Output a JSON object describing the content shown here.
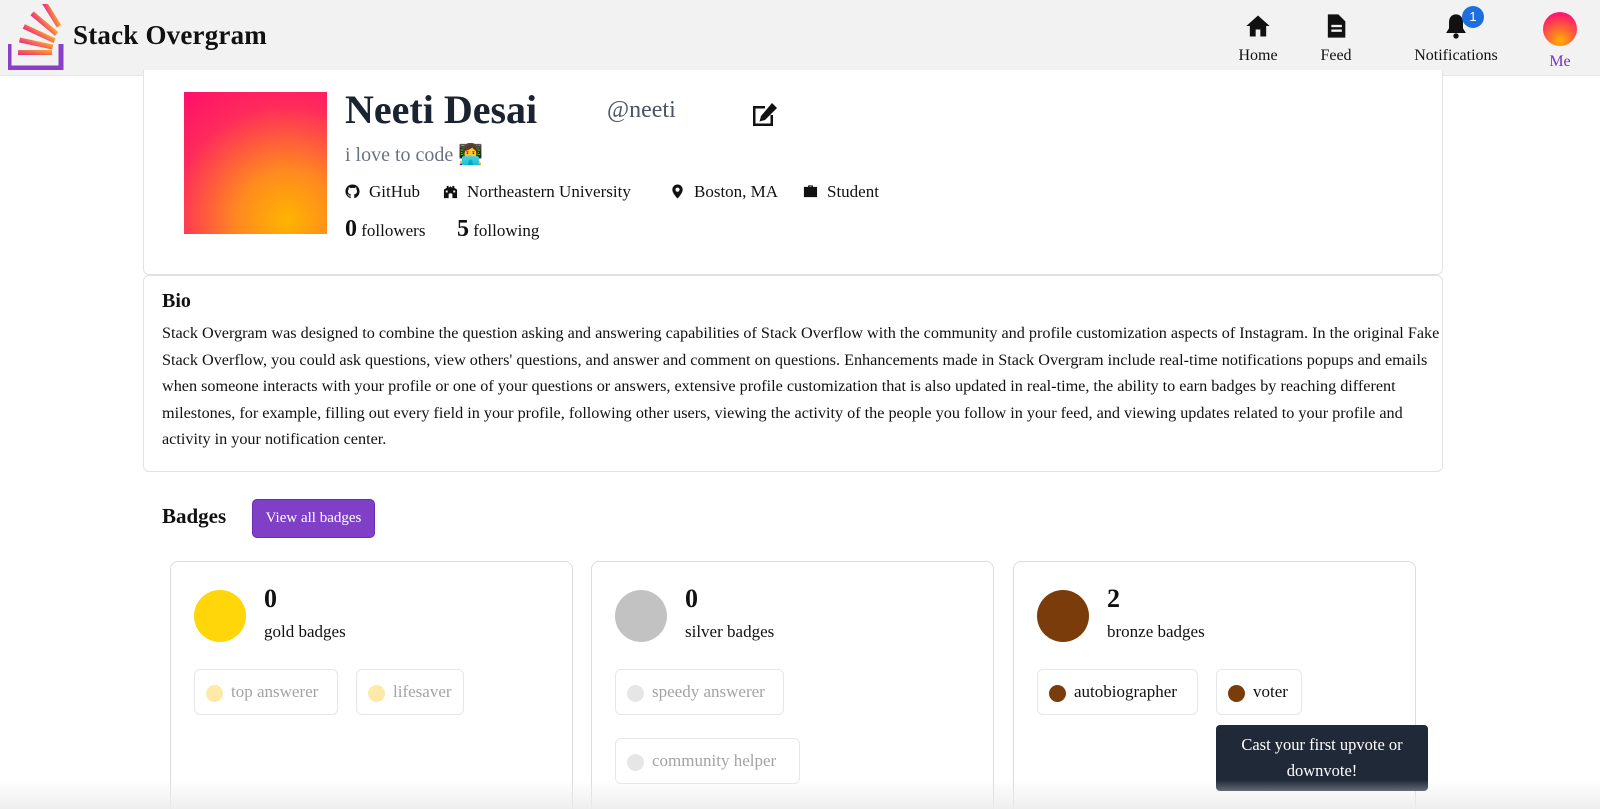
{
  "app": {
    "brand": "Stack Overgram"
  },
  "nav": {
    "home": "Home",
    "feed": "Feed",
    "notifications": "Notifications",
    "notifications_count": "1",
    "me": "Me"
  },
  "profile": {
    "name": "Neeti Desai",
    "handle": "@neeti",
    "tagline": "i love to code 👩‍💻",
    "github": "GitHub",
    "school": "Northeastern University",
    "location": "Boston, MA",
    "occupation": "Student",
    "followers_count": "0",
    "followers_label": "followers",
    "following_count": "5",
    "following_label": "following"
  },
  "bio": {
    "title": "Bio",
    "text": "Stack Overgram was designed to combine the question asking and answering capabilities of Stack Overflow with the community and profile customization aspects of Instagram. In the original Fake Stack Overflow, you could ask questions, view others' questions, and answer and comment on questions. Enhancements made in Stack Overgram include real-time notifications popups and emails when someone interacts with your profile or one of your questions or answers, extensive profile customization that is also updated in real-time, the ability to earn badges by reaching different milestones, for example, filling out every field in your profile, following other users, viewing the activity of the people you follow in your feed, and viewing updates related to your profile and activity in your notification center."
  },
  "badges": {
    "title": "Badges",
    "view_all": "View all badges",
    "gold": {
      "count": "0",
      "label": "gold badges",
      "color": "#ffd60a",
      "items": [
        "top answerer",
        "lifesaver"
      ]
    },
    "silver": {
      "count": "0",
      "label": "silver badges",
      "color": "#c2c2c2",
      "items": [
        "speedy answerer",
        "community helper"
      ]
    },
    "bronze": {
      "count": "2",
      "label": "bronze badges",
      "color": "#7a3c0b",
      "items": [
        "autobiographer",
        "voter"
      ]
    }
  },
  "tooltip": {
    "text": "Cast your first upvote or downvote!"
  },
  "colors": {
    "accent": "#7f3fc6",
    "notification_badge": "#1d6fe0",
    "tooltip_bg": "#1f2937"
  }
}
